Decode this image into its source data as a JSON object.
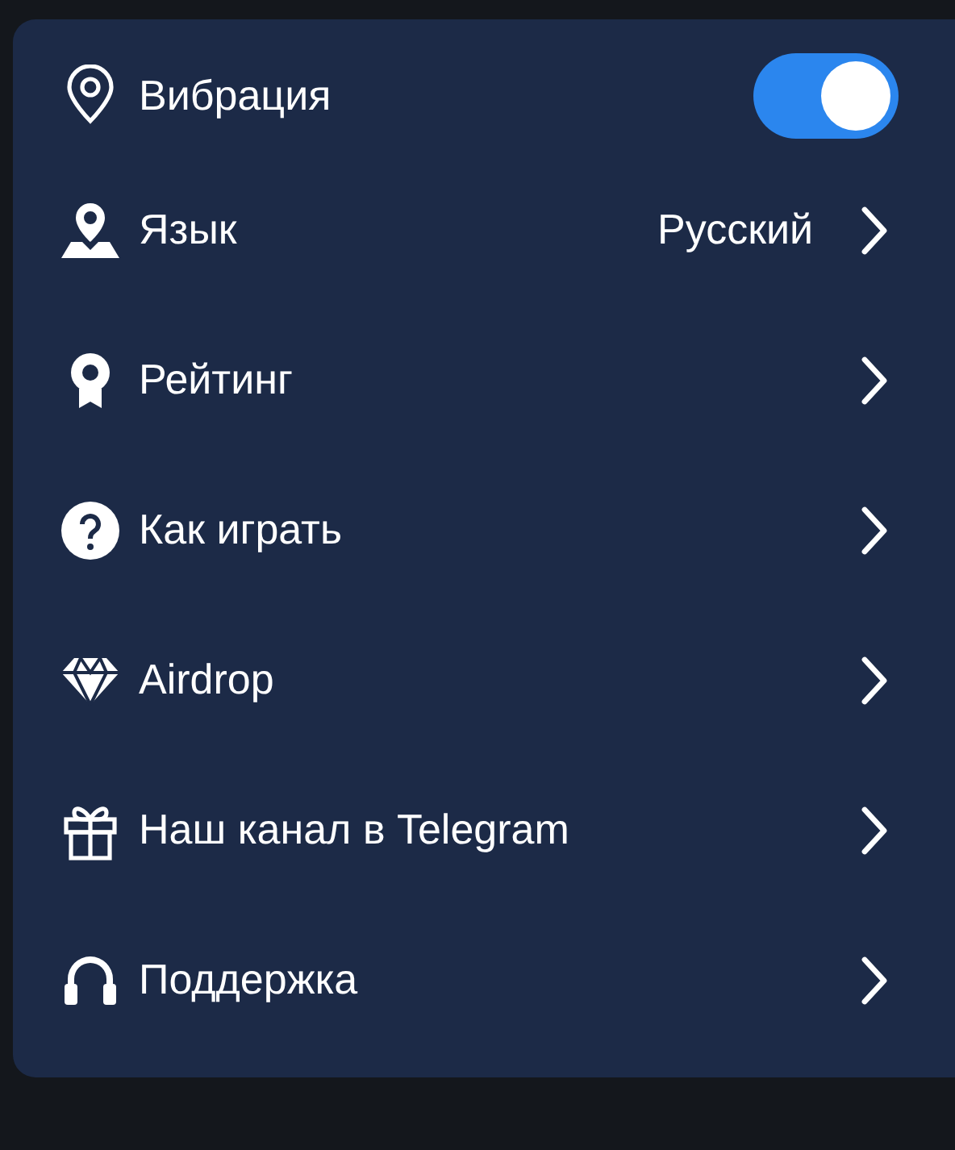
{
  "menu": [
    {
      "kind": "toggle",
      "label": "Вибрация",
      "on": true
    },
    {
      "kind": "link",
      "label": "Язык",
      "value": "Русский"
    },
    {
      "kind": "link",
      "label": "Рейтинг"
    },
    {
      "kind": "link",
      "label": "Как играть"
    },
    {
      "kind": "link",
      "label": "Airdrop"
    },
    {
      "kind": "link",
      "label": "Наш канал в Telegram"
    },
    {
      "kind": "link",
      "label": "Поддержка"
    }
  ]
}
